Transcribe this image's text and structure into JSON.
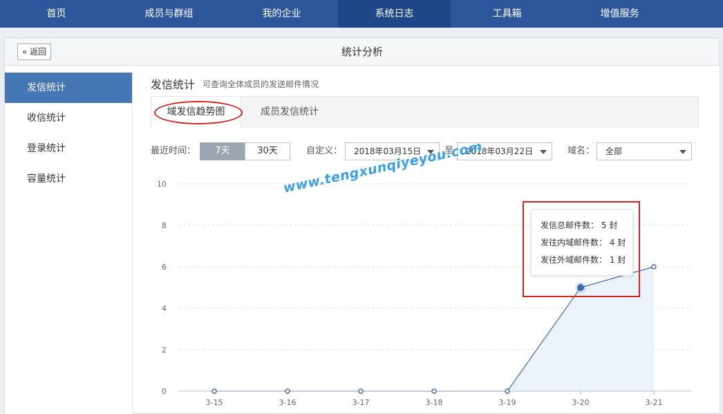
{
  "topnav": {
    "items": [
      {
        "label": "首页"
      },
      {
        "label": "成员与群组"
      },
      {
        "label": "我的企业"
      },
      {
        "label": "系统日志",
        "active": true
      },
      {
        "label": "工具箱"
      },
      {
        "label": "增值服务"
      }
    ]
  },
  "header": {
    "back_label": "« 返回",
    "title": "统计分析"
  },
  "sidebar": {
    "items": [
      {
        "label": "发信统计",
        "active": true
      },
      {
        "label": "收信统计"
      },
      {
        "label": "登录统计"
      },
      {
        "label": "容量统计"
      }
    ]
  },
  "section": {
    "title": "发信统计",
    "desc": "可查询全体成员的发送邮件情况"
  },
  "tabs": [
    {
      "label": "域发信趋势图",
      "active": true
    },
    {
      "label": "成员发信统计"
    }
  ],
  "filters": {
    "recent_label": "最近时间：",
    "range_7": "7天",
    "range_30": "30天",
    "custom_label": "自定义：",
    "start_date": "2018年03月15日",
    "to_label": "至",
    "end_date": "2018年03月22日",
    "domain_label": "域名：",
    "domain_value": "全部"
  },
  "chart_data": {
    "type": "area",
    "categories": [
      "3-15",
      "3-16",
      "3-17",
      "3-18",
      "3-19",
      "3-20",
      "3-21"
    ],
    "values": [
      0,
      0,
      0,
      0,
      0,
      5,
      6
    ],
    "ylim": [
      0,
      10
    ],
    "yticks": [
      "0",
      "2",
      "4",
      "6",
      "8",
      "10"
    ],
    "grid": true,
    "highlight_index": 5,
    "line_color": "#3d6aa8",
    "fill_color": "#edf3fb"
  },
  "tooltip": {
    "total": "发信总邮件数： 5 封",
    "internal": "发往内域邮件数： 4 封",
    "external": "发往外域邮件数： 1 封"
  },
  "watermark": "www.tengxunqiyeyou.com"
}
